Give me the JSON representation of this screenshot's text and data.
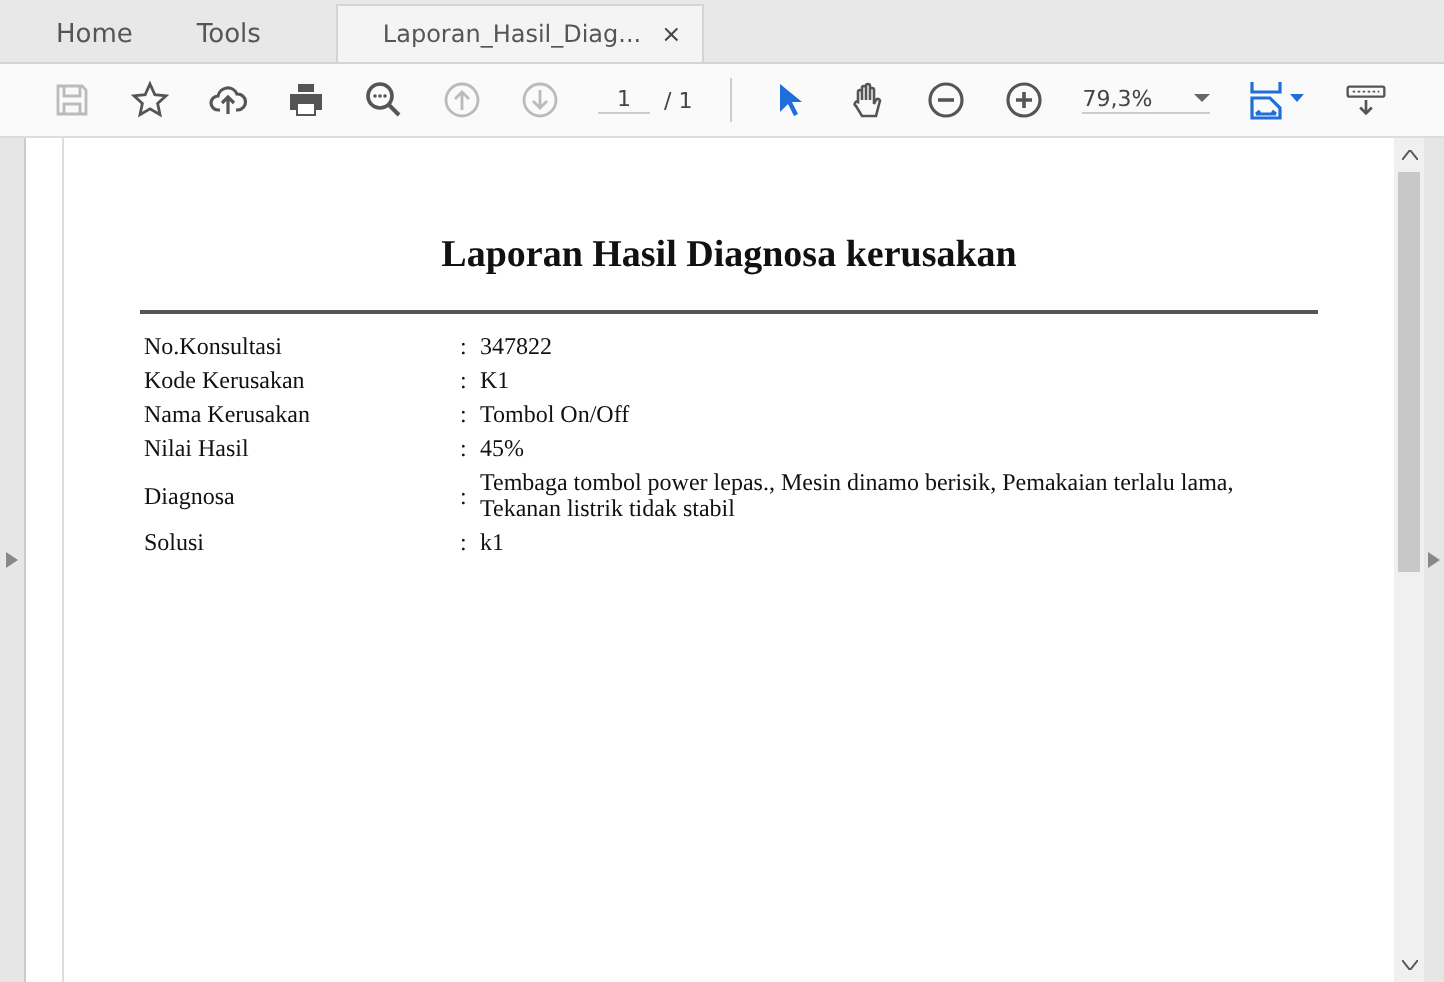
{
  "tabs": [
    {
      "label": "Home",
      "selected": false
    },
    {
      "label": "Tools",
      "selected": false
    },
    {
      "label": "Laporan_Hasil_Diag...",
      "selected": true,
      "close": "×"
    }
  ],
  "toolbar": {
    "page": "1",
    "page_total": "/ 1",
    "zoom": "79,3%"
  },
  "document": {
    "title": "Laporan Hasil Diagnosa kerusakan",
    "rows": [
      {
        "label": "No.Konsultasi",
        "value": "347822"
      },
      {
        "label": "Kode Kerusakan",
        "value": "K1"
      },
      {
        "label": "Nama Kerusakan",
        "value": "Tombol On/Off"
      },
      {
        "label": "Nilai Hasil",
        "value": "45%"
      },
      {
        "label": "Diagnosa",
        "value": "Tembaga tombol power lepas., Mesin dinamo berisik, Pemakaian terlalu lama, Tekanan listrik tidak stabil"
      },
      {
        "label": "Solusi",
        "value": "k1"
      }
    ],
    "separator": ":"
  }
}
